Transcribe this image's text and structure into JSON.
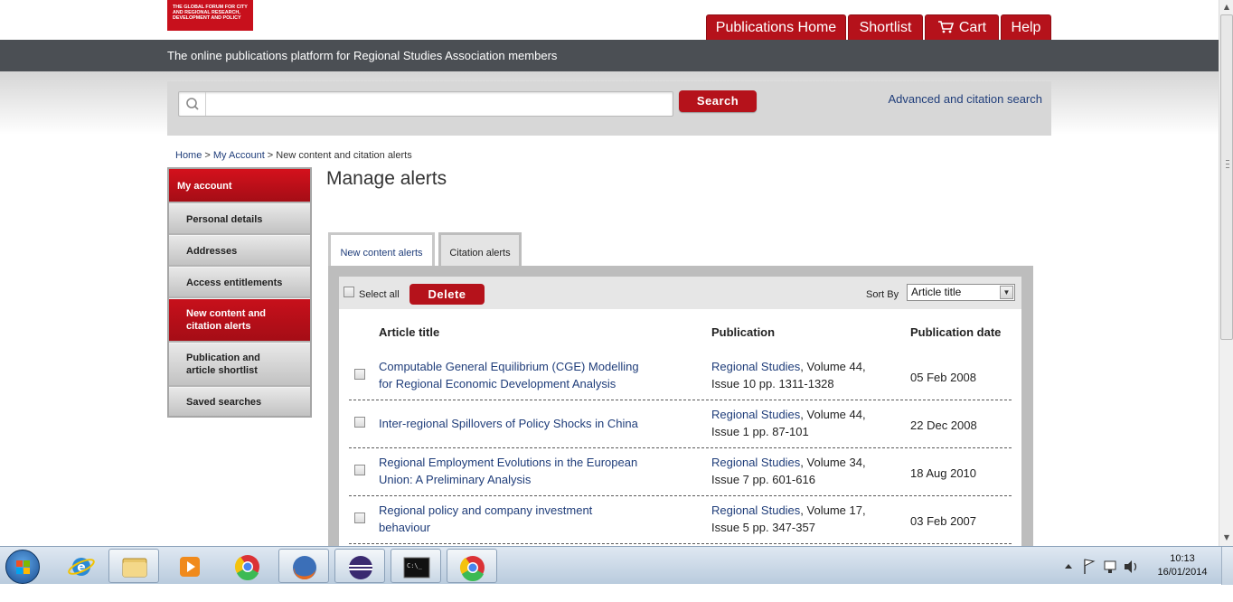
{
  "header": {
    "logo_lines": [
      "THE GLOBAL FORUM FOR CITY",
      "AND REGIONAL RESEARCH,",
      "DEVELOPMENT AND POLICY"
    ],
    "nav": [
      {
        "label": "Publications Home"
      },
      {
        "label": "Shortlist"
      },
      {
        "label": "Cart",
        "icon": "cart-icon"
      },
      {
        "label": "Help"
      }
    ],
    "tagline": "The online publications platform for Regional Studies Association members"
  },
  "search": {
    "placeholder": "",
    "button_label": "Search",
    "advanced_link": "Advanced and citation search"
  },
  "breadcrumb": {
    "home": "Home",
    "sep1": " > ",
    "account": "My Account",
    "sep2": " > ",
    "current": "New content and citation alerts"
  },
  "sidebar": {
    "header": "My account",
    "items": [
      {
        "label_lines": [
          "Personal details"
        ],
        "active": false
      },
      {
        "label_lines": [
          "Addresses"
        ],
        "active": false
      },
      {
        "label_lines": [
          "Access entitlements"
        ],
        "active": false
      },
      {
        "label_lines": [
          "New content and",
          "citation alerts"
        ],
        "active": true
      },
      {
        "label_lines": [
          "Publication and",
          "article shortlist"
        ],
        "active": false
      },
      {
        "label_lines": [
          "Saved searches"
        ],
        "active": false
      }
    ]
  },
  "main": {
    "title": "Manage alerts",
    "tabs": [
      {
        "label": "New content alerts",
        "active": true
      },
      {
        "label": "Citation alerts",
        "active": false
      }
    ],
    "toolbar": {
      "select_all": "Select all",
      "delete_label": "Delete",
      "sort_label": "Sort By",
      "sort_value": "Article title"
    },
    "columns": {
      "title": "Article title",
      "publication": "Publication",
      "date": "Publication date"
    },
    "rows": [
      {
        "title_lines": [
          "Computable General Equilibrium (CGE) Modelling",
          "for Regional Economic Development Analysis"
        ],
        "journal": "Regional Studies",
        "pub_rest_line1": ", Volume 44,",
        "pub_line2": "Issue 10 pp. 1311-1328",
        "date": "05 Feb 2008",
        "checked": false
      },
      {
        "title_lines": [
          "Inter-regional Spillovers of Policy Shocks in China"
        ],
        "journal": "Regional Studies",
        "pub_rest_line1": ", Volume 44,",
        "pub_line2": "Issue 1 pp. 87-101",
        "date": "22 Dec 2008",
        "checked": false
      },
      {
        "title_lines": [
          "Regional Employment Evolutions in the European",
          "Union: A Preliminary Analysis"
        ],
        "journal": "Regional Studies",
        "pub_rest_line1": ", Volume 34,",
        "pub_line2": "Issue 7 pp. 601-616",
        "date": "18 Aug 2010",
        "checked": false
      },
      {
        "title_lines": [
          "Regional policy and company investment",
          "behaviour"
        ],
        "journal": "Regional Studies",
        "pub_rest_line1": ", Volume 17,",
        "pub_line2": "Issue 5 pp. 347-357",
        "date": "03 Feb 2007",
        "checked": false
      }
    ]
  },
  "taskbar": {
    "apps": [
      {
        "icon": "internet-explorer-icon",
        "open": false
      },
      {
        "icon": "file-explorer-icon",
        "open": true
      },
      {
        "icon": "media-player-icon",
        "open": false
      },
      {
        "icon": "chrome-icon",
        "open": false
      },
      {
        "icon": "firefox-icon",
        "open": true
      },
      {
        "icon": "eclipse-icon",
        "open": true
      },
      {
        "icon": "command-prompt-icon",
        "open": true
      },
      {
        "icon": "chrome-icon",
        "open": true
      }
    ],
    "time": "10:13",
    "date": "16/01/2014"
  },
  "colors": {
    "brand_red": "#b5121b",
    "header_grey": "#4b4f54",
    "link_blue": "#1f3d7a"
  }
}
